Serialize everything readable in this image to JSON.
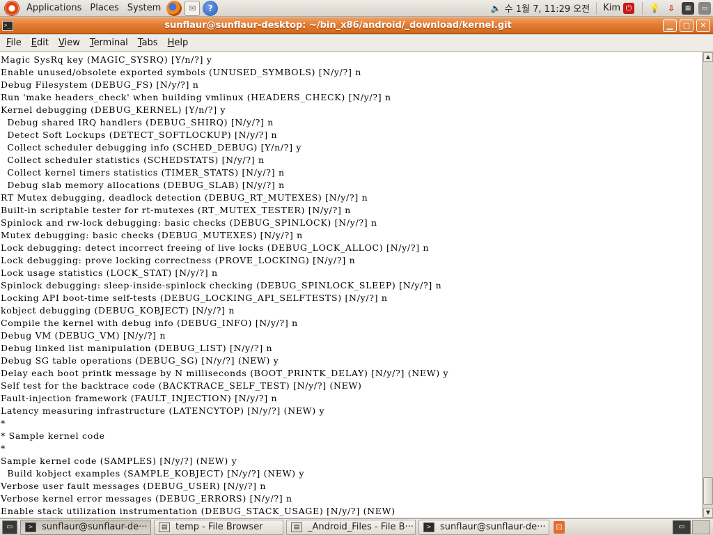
{
  "top_panel": {
    "menus": [
      "Applications",
      "Places",
      "System"
    ],
    "clock": "수 1월 7, 11:29 오전",
    "user": "Kim"
  },
  "window": {
    "title": "sunflaur@sunflaur-desktop: ~/bin_x86/android/_download/kernel.git"
  },
  "menubar": {
    "items": [
      {
        "mnemonic": "F",
        "rest": "ile"
      },
      {
        "mnemonic": "E",
        "rest": "dit"
      },
      {
        "mnemonic": "V",
        "rest": "iew"
      },
      {
        "mnemonic": "T",
        "rest": "erminal"
      },
      {
        "mnemonic": "T",
        "rest": "abs"
      },
      {
        "mnemonic": "H",
        "rest": "elp"
      }
    ]
  },
  "terminal": {
    "lines": [
      "Magic SysRq key (MAGIC_SYSRQ) [Y/n/?] y",
      "Enable unused/obsolete exported symbols (UNUSED_SYMBOLS) [N/y/?] n",
      "Debug Filesystem (DEBUG_FS) [N/y/?] n",
      "Run 'make headers_check' when building vmlinux (HEADERS_CHECK) [N/y/?] n",
      "Kernel debugging (DEBUG_KERNEL) [Y/n/?] y",
      "  Debug shared IRQ handlers (DEBUG_SHIRQ) [N/y/?] n",
      "  Detect Soft Lockups (DETECT_SOFTLOCKUP) [N/y/?] n",
      "  Collect scheduler debugging info (SCHED_DEBUG) [Y/n/?] y",
      "  Collect scheduler statistics (SCHEDSTATS) [N/y/?] n",
      "  Collect kernel timers statistics (TIMER_STATS) [N/y/?] n",
      "  Debug slab memory allocations (DEBUG_SLAB) [N/y/?] n",
      "RT Mutex debugging, deadlock detection (DEBUG_RT_MUTEXES) [N/y/?] n",
      "Built-in scriptable tester for rt-mutexes (RT_MUTEX_TESTER) [N/y/?] n",
      "Spinlock and rw-lock debugging: basic checks (DEBUG_SPINLOCK) [N/y/?] n",
      "Mutex debugging: basic checks (DEBUG_MUTEXES) [N/y/?] n",
      "Lock debugging: detect incorrect freeing of live locks (DEBUG_LOCK_ALLOC) [N/y/?] n",
      "Lock debugging: prove locking correctness (PROVE_LOCKING) [N/y/?] n",
      "Lock usage statistics (LOCK_STAT) [N/y/?] n",
      "Spinlock debugging: sleep-inside-spinlock checking (DEBUG_SPINLOCK_SLEEP) [N/y/?] n",
      "Locking API boot-time self-tests (DEBUG_LOCKING_API_SELFTESTS) [N/y/?] n",
      "kobject debugging (DEBUG_KOBJECT) [N/y/?] n",
      "Compile the kernel with debug info (DEBUG_INFO) [N/y/?] n",
      "Debug VM (DEBUG_VM) [N/y/?] n",
      "Debug linked list manipulation (DEBUG_LIST) [N/y/?] n",
      "Debug SG table operations (DEBUG_SG) [N/y/?] (NEW) y",
      "Delay each boot printk message by N milliseconds (BOOT_PRINTK_DELAY) [N/y/?] (NEW) y",
      "Self test for the backtrace code (BACKTRACE_SELF_TEST) [N/y/?] (NEW)",
      "Fault-injection framework (FAULT_INJECTION) [N/y/?] n",
      "Latency measuring infrastructure (LATENCYTOP) [N/y/?] (NEW) y",
      "*",
      "* Sample kernel code",
      "*",
      "Sample kernel code (SAMPLES) [N/y/?] (NEW) y",
      "  Build kobject examples (SAMPLE_KOBJECT) [N/y/?] (NEW) y",
      "Verbose user fault messages (DEBUG_USER) [N/y/?] n",
      "Verbose kernel error messages (DEBUG_ERRORS) [N/y/?] n",
      "Enable stack utilization instrumentation (DEBUG_STACK_USAGE) [N/y/?] (NEW)"
    ]
  },
  "taskbar": {
    "tasks": [
      {
        "label": "sunflaur@sunflaur-de···",
        "icon": "terminal-icon",
        "active": true
      },
      {
        "label": "temp - File Browser",
        "icon": "folder-icon",
        "active": false
      },
      {
        "label": "_Android_Files - File B···",
        "icon": "folder-icon",
        "active": false
      },
      {
        "label": "sunflaur@sunflaur-de···",
        "icon": "terminal-icon",
        "active": false
      }
    ]
  },
  "colors": {
    "titlebar": "#e27a2f",
    "panel": "#d9d5cd",
    "terminal_bg": "#ffffff"
  }
}
